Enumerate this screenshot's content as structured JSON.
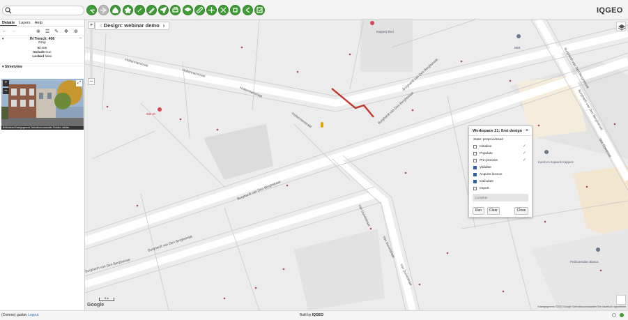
{
  "brand": {
    "logo": "IQGEO",
    "accent": "#3f9b35"
  },
  "toolbar": {
    "search": {
      "placeholder": ""
    },
    "buttons": [
      "back-icon",
      "forward-icon",
      "home-icon",
      "star-icon",
      "link-icon",
      "pencil-icon",
      "locate-icon",
      "print-icon",
      "layers-icon",
      "measure-icon",
      "split-icon",
      "tools-icon",
      "network-icon",
      "share-icon",
      "workflow-icon"
    ]
  },
  "left_panel": {
    "tabs": [
      "Details",
      "Layers",
      "Help"
    ],
    "feature": {
      "title": "IN Trench: 406",
      "subtitle": "Drop",
      "fields": [
        {
          "label": "Id",
          "value": "406"
        },
        {
          "label": "Include",
          "value": "true"
        },
        {
          "label": "Locked",
          "value": "false"
        }
      ]
    },
    "streetview": {
      "label": "Streetview",
      "caption": "Bullenstraat   Kaartgegevens   Gebruiksvoorwaarden   Problem melden"
    }
  },
  "map": {
    "design_title": "Design: webinar demo",
    "streets": [
      "Holtermanstraat",
      "Holtermanstraat",
      "Holtermanstraat",
      "Holtermanstraat",
      "Burghardt van Den Berghstraat",
      "Burghardt van Den Berghstraat",
      "Burghardt van Den Berghstraat",
      "Burghardt van Den Berghstraat",
      "Van Duivestraat",
      "Van Duivestraat",
      "Van Duivestraat",
      "Burgharth van Den Berghstraat",
      "Burgharth van Den Berghstraat",
      "Burgharth van Den Berghstraat",
      "Slot Roestraat"
    ],
    "places": [
      "Kapperij Ekel",
      "BBB",
      "Kunst en Kopwerk Kappers",
      "Pedicuresalon Bianca",
      "888 JR"
    ],
    "copyright": "Kaartgegevens ©2023 Google   Gebruiksvoorwaarden   Een kaartfout rapporteren",
    "google": "Google",
    "scale": "5 m"
  },
  "workflow": {
    "title": "Workspace 21: first design",
    "state": "State: preprocessed",
    "steps": [
      {
        "label": "Initialise",
        "checked": false,
        "done": true
      },
      {
        "label": "Populate",
        "checked": false,
        "done": true
      },
      {
        "label": "Pre-process",
        "checked": false,
        "done": true
      },
      {
        "label": "Validate",
        "checked": true,
        "done": false
      },
      {
        "label": "Acquire licence",
        "checked": true,
        "done": false
      },
      {
        "label": "Calculate",
        "checked": true,
        "done": false
      },
      {
        "label": "Import",
        "checked": false,
        "done": false
      }
    ],
    "status": "Complete",
    "run_label": "Run",
    "clear_label": "Clear",
    "close_label": "Close"
  },
  "footer": {
    "user": "(Comms) gustav",
    "logout": "Logout",
    "built_by": "Built by",
    "built_brand": "IQGEO"
  }
}
